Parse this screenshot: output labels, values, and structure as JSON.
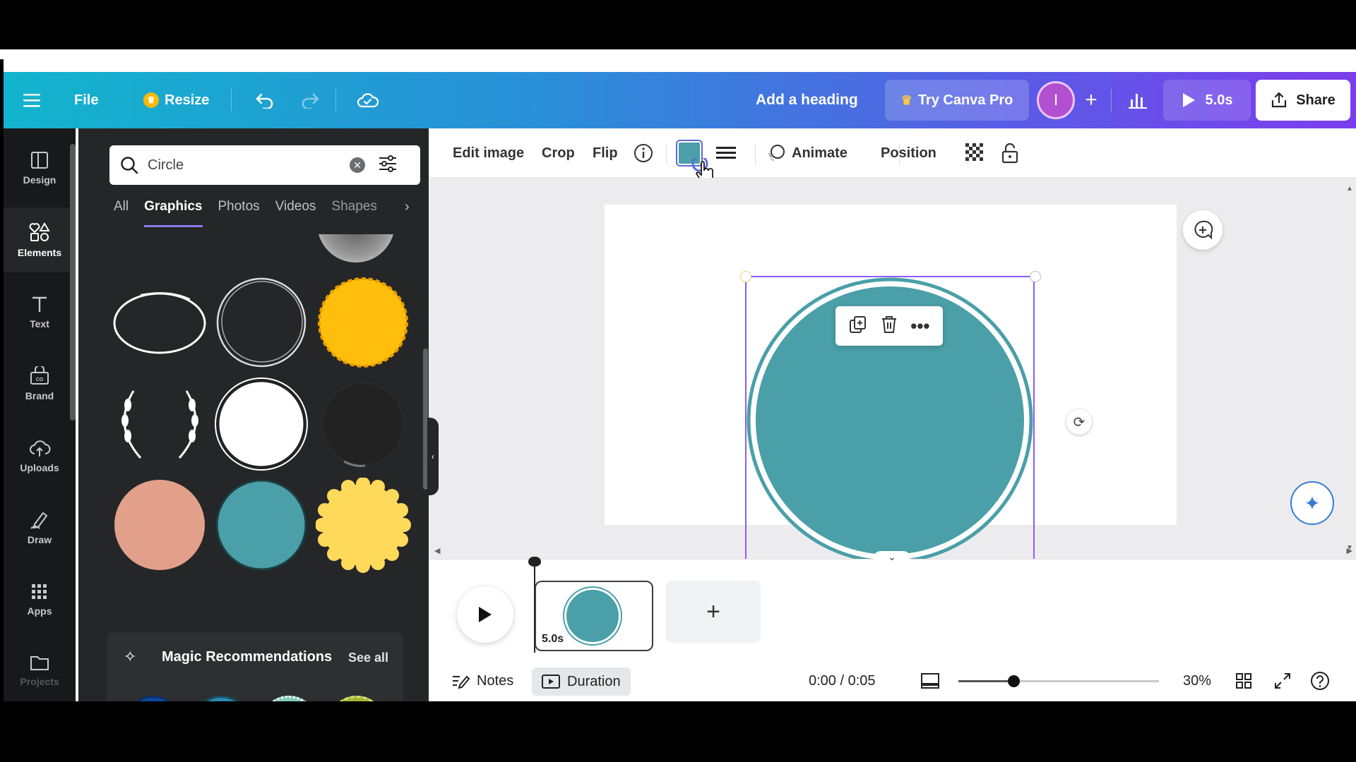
{
  "header": {
    "file_label": "File",
    "resize_label": "Resize",
    "heading_label": "Add a heading",
    "try_pro_label": "Try Canva Pro",
    "avatar_initial": "I",
    "play_duration": "5.0s",
    "share_label": "Share"
  },
  "rail": {
    "items": [
      {
        "label": "Design",
        "icon": "design-icon"
      },
      {
        "label": "Elements",
        "icon": "elements-icon"
      },
      {
        "label": "Text",
        "icon": "text-icon"
      },
      {
        "label": "Brand",
        "icon": "brand-icon"
      },
      {
        "label": "Uploads",
        "icon": "uploads-icon"
      },
      {
        "label": "Draw",
        "icon": "draw-icon"
      },
      {
        "label": "Apps",
        "icon": "apps-icon"
      },
      {
        "label": "Projects",
        "icon": "projects-icon"
      }
    ]
  },
  "panel": {
    "search_value": "Circle",
    "tabs": [
      "All",
      "Graphics",
      "Photos",
      "Videos",
      "Shapes"
    ],
    "active_tab": "Graphics",
    "magic_title": "Magic Recommendations",
    "see_all": "See all"
  },
  "toolbar": {
    "edit_image": "Edit image",
    "crop": "Crop",
    "flip": "Flip",
    "animate": "Animate",
    "position": "Position",
    "fill_color": "#4a9fa8"
  },
  "timeline": {
    "clip_duration": "5.0s"
  },
  "footer": {
    "notes": "Notes",
    "duration": "Duration",
    "time": "0:00 / 0:05",
    "zoom": "30%",
    "zoom_level": 0.3
  },
  "colors": {
    "teal": "#4a9fa8",
    "salmon": "#e2a08b",
    "yellow": "#ffd95a",
    "orange": "#ffbe0b",
    "navy": "#11489c",
    "blue": "#2a8bb0",
    "mint": "#86cdb8",
    "olive": "#a5b537",
    "selection": "#8b5cf6"
  }
}
